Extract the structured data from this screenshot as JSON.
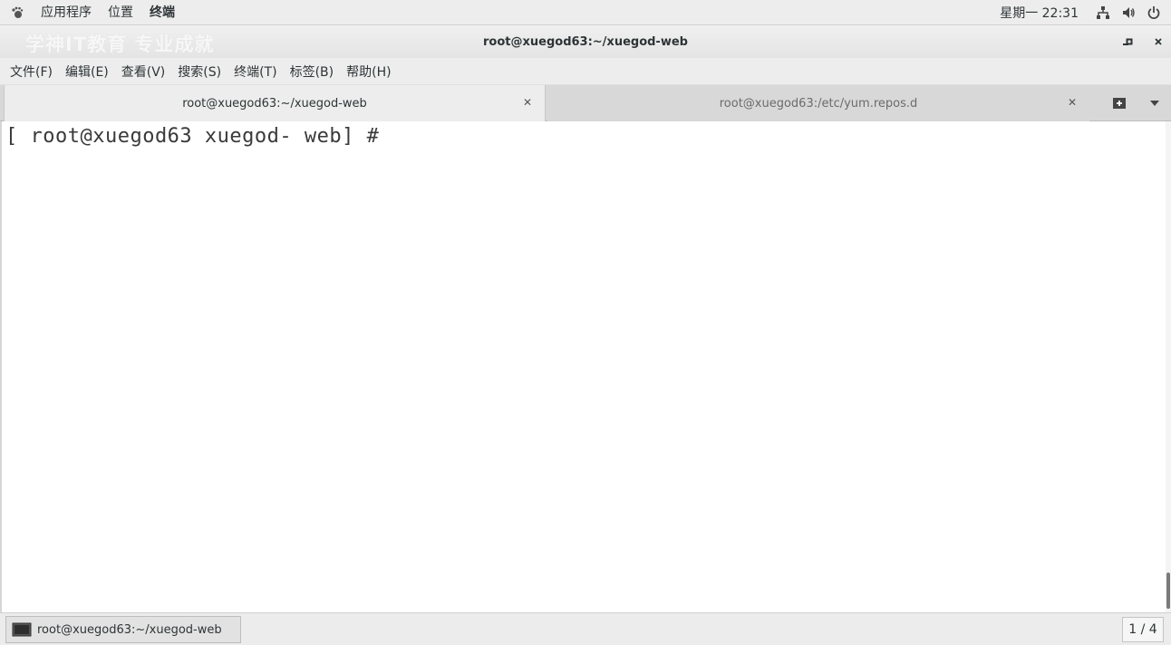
{
  "top_panel": {
    "menus": [
      "应用程序",
      "位置",
      "终端"
    ],
    "active_menu": "终端",
    "clock": "星期一 22:31"
  },
  "window": {
    "watermark": "学神IT教育 专业成就",
    "title": "root@xuegod63:~/xuegod-web"
  },
  "menubar": {
    "items": [
      "文件(F)",
      "编辑(E)",
      "查看(V)",
      "搜索(S)",
      "终端(T)",
      "标签(B)",
      "帮助(H)"
    ]
  },
  "tabs": [
    {
      "label": "root@xuegod63:~/xuegod-web",
      "active": true
    },
    {
      "label": "root@xuegod63:/etc/yum.repos.d",
      "active": false
    }
  ],
  "terminal": {
    "prompt": "[ root@xuegod63 xuegod- web] #"
  },
  "taskbar": {
    "task_label": "root@xuegod63:~/xuegod-web",
    "pager": "1 / 4"
  },
  "icons": {
    "app": "gnome-foot-icon",
    "network": "network-icon",
    "volume": "volume-icon",
    "power": "power-icon"
  }
}
